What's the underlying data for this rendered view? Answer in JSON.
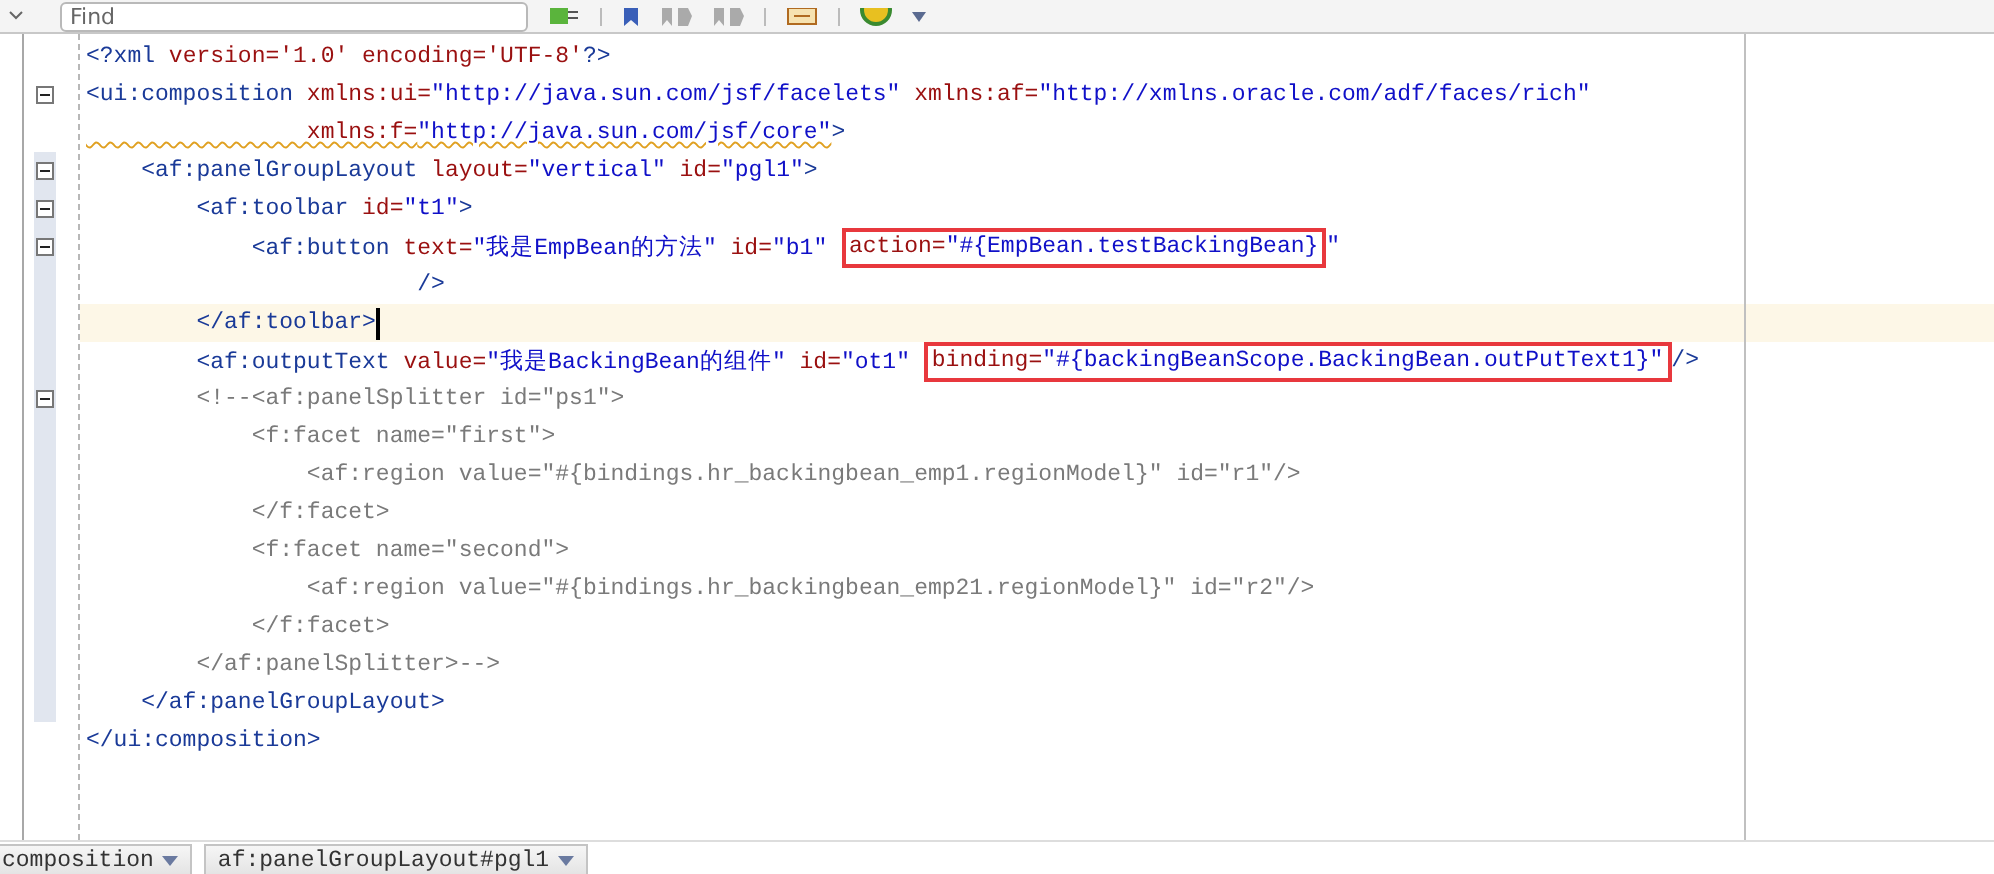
{
  "toolbar": {
    "find": {
      "placeholder": "Find"
    }
  },
  "lines": [
    {
      "fold": false,
      "fold_range": false,
      "current": false,
      "tokens": [
        {
          "kind": "tag",
          "text": "<?xml"
        },
        {
          "kind": "attr",
          "text": " version='1.0' encoding='UTF-8'"
        },
        {
          "kind": "tag",
          "text": "?>"
        }
      ]
    },
    {
      "fold": true,
      "fold_range": false,
      "current": false,
      "tokens": [
        {
          "kind": "tag",
          "text": "<ui:composition"
        },
        {
          "kind": "attr",
          "text": " xmlns:ui="
        },
        {
          "kind": "value",
          "text": "\"http://java.sun.com/jsf/facelets\""
        },
        {
          "kind": "attr",
          "text": " xmlns:af="
        },
        {
          "kind": "value",
          "text": "\"http://xmlns.oracle.com/adf/faces/rich\""
        }
      ]
    },
    {
      "fold": false,
      "fold_range": false,
      "current": false,
      "tokens": [
        {
          "kind": "attr",
          "text": "                xmlns:f=",
          "warning": true
        },
        {
          "kind": "value",
          "text": "\"http://java.sun.com/jsf/core\"",
          "warning": true
        },
        {
          "kind": "tag",
          "text": ">"
        }
      ]
    },
    {
      "fold": true,
      "fold_range": true,
      "current": false,
      "tokens": [
        {
          "kind": "tag",
          "text": "    <af:panelGroupLayout"
        },
        {
          "kind": "attr",
          "text": " layout="
        },
        {
          "kind": "value",
          "text": "\"vertical\""
        },
        {
          "kind": "attr",
          "text": " id="
        },
        {
          "kind": "value",
          "text": "\"pgl1\""
        },
        {
          "kind": "tag",
          "text": ">"
        }
      ]
    },
    {
      "fold": true,
      "fold_range": true,
      "current": false,
      "tokens": [
        {
          "kind": "tag",
          "text": "        <af:toolbar"
        },
        {
          "kind": "attr",
          "text": " id="
        },
        {
          "kind": "value",
          "text": "\"t1\""
        },
        {
          "kind": "tag",
          "text": ">"
        }
      ]
    },
    {
      "fold": true,
      "fold_range": true,
      "current": false,
      "tokens": [
        {
          "kind": "tag",
          "text": "            <af:button"
        },
        {
          "kind": "attr",
          "text": " text="
        },
        {
          "kind": "value",
          "text": "\"我是EmpBean的方法\""
        },
        {
          "kind": "attr",
          "text": " id="
        },
        {
          "kind": "value",
          "text": "\"b1\" "
        },
        {
          "kind": "box",
          "tokens": [
            {
              "kind": "attr",
              "text": "action="
            },
            {
              "kind": "value",
              "text": "\"#{EmpBean.testBackingBean}"
            }
          ]
        },
        {
          "kind": "value",
          "text": "\""
        }
      ]
    },
    {
      "fold": false,
      "fold_range": true,
      "current": false,
      "tokens": [
        {
          "kind": "tag",
          "text": "                        />"
        }
      ]
    },
    {
      "fold": false,
      "fold_range": true,
      "current": true,
      "tokens": [
        {
          "kind": "tag",
          "text": "        </af:toolbar>"
        }
      ]
    },
    {
      "fold": false,
      "fold_range": true,
      "current": false,
      "tokens": [
        {
          "kind": "tag",
          "text": "        <af:outputText"
        },
        {
          "kind": "attr",
          "text": " value="
        },
        {
          "kind": "value",
          "text": "\"我是BackingBean的组件\""
        },
        {
          "kind": "attr",
          "text": " id="
        },
        {
          "kind": "value",
          "text": "\"ot1\" "
        },
        {
          "kind": "box",
          "tokens": [
            {
              "kind": "attr",
              "text": "binding="
            },
            {
              "kind": "value",
              "text": "\"#{backingBeanScope.BackingBean.outPutText1}\""
            }
          ]
        },
        {
          "kind": "tag",
          "text": "/>"
        }
      ]
    },
    {
      "fold": true,
      "fold_range": true,
      "current": false,
      "tokens": [
        {
          "kind": "comment",
          "text": "        <!--<af:panelSplitter id=\"ps1\">"
        }
      ]
    },
    {
      "fold": false,
      "fold_range": true,
      "current": false,
      "tokens": [
        {
          "kind": "comment",
          "text": "            <f:facet name=\"first\">"
        }
      ]
    },
    {
      "fold": false,
      "fold_range": true,
      "current": false,
      "tokens": [
        {
          "kind": "comment",
          "text": "                <af:region value=\"#{bindings.hr_backingbean_emp1.regionModel}\" id=\"r1\"/>"
        }
      ]
    },
    {
      "fold": false,
      "fold_range": true,
      "current": false,
      "tokens": [
        {
          "kind": "comment",
          "text": "            </f:facet>"
        }
      ]
    },
    {
      "fold": false,
      "fold_range": true,
      "current": false,
      "tokens": [
        {
          "kind": "comment",
          "text": "            <f:facet name=\"second\">"
        }
      ]
    },
    {
      "fold": false,
      "fold_range": true,
      "current": false,
      "tokens": [
        {
          "kind": "comment",
          "text": "                <af:region value=\"#{bindings.hr_backingbean_emp21.regionModel}\" id=\"r2\"/>"
        }
      ]
    },
    {
      "fold": false,
      "fold_range": true,
      "current": false,
      "tokens": [
        {
          "kind": "comment",
          "text": "            </f:facet>"
        }
      ]
    },
    {
      "fold": false,
      "fold_range": true,
      "current": false,
      "tokens": [
        {
          "kind": "comment",
          "text": "        </af:panelSplitter>-->"
        }
      ]
    },
    {
      "fold": false,
      "fold_range": true,
      "current": false,
      "tokens": [
        {
          "kind": "tag",
          "text": "    </af:panelGroupLayout>"
        }
      ]
    },
    {
      "fold": false,
      "fold_range": false,
      "current": false,
      "tokens": [
        {
          "kind": "tag",
          "text": "</ui:composition>"
        }
      ]
    }
  ],
  "breadcrumbs": [
    {
      "label": "composition"
    },
    {
      "label": "af:panelGroupLayout#pgl1"
    }
  ]
}
